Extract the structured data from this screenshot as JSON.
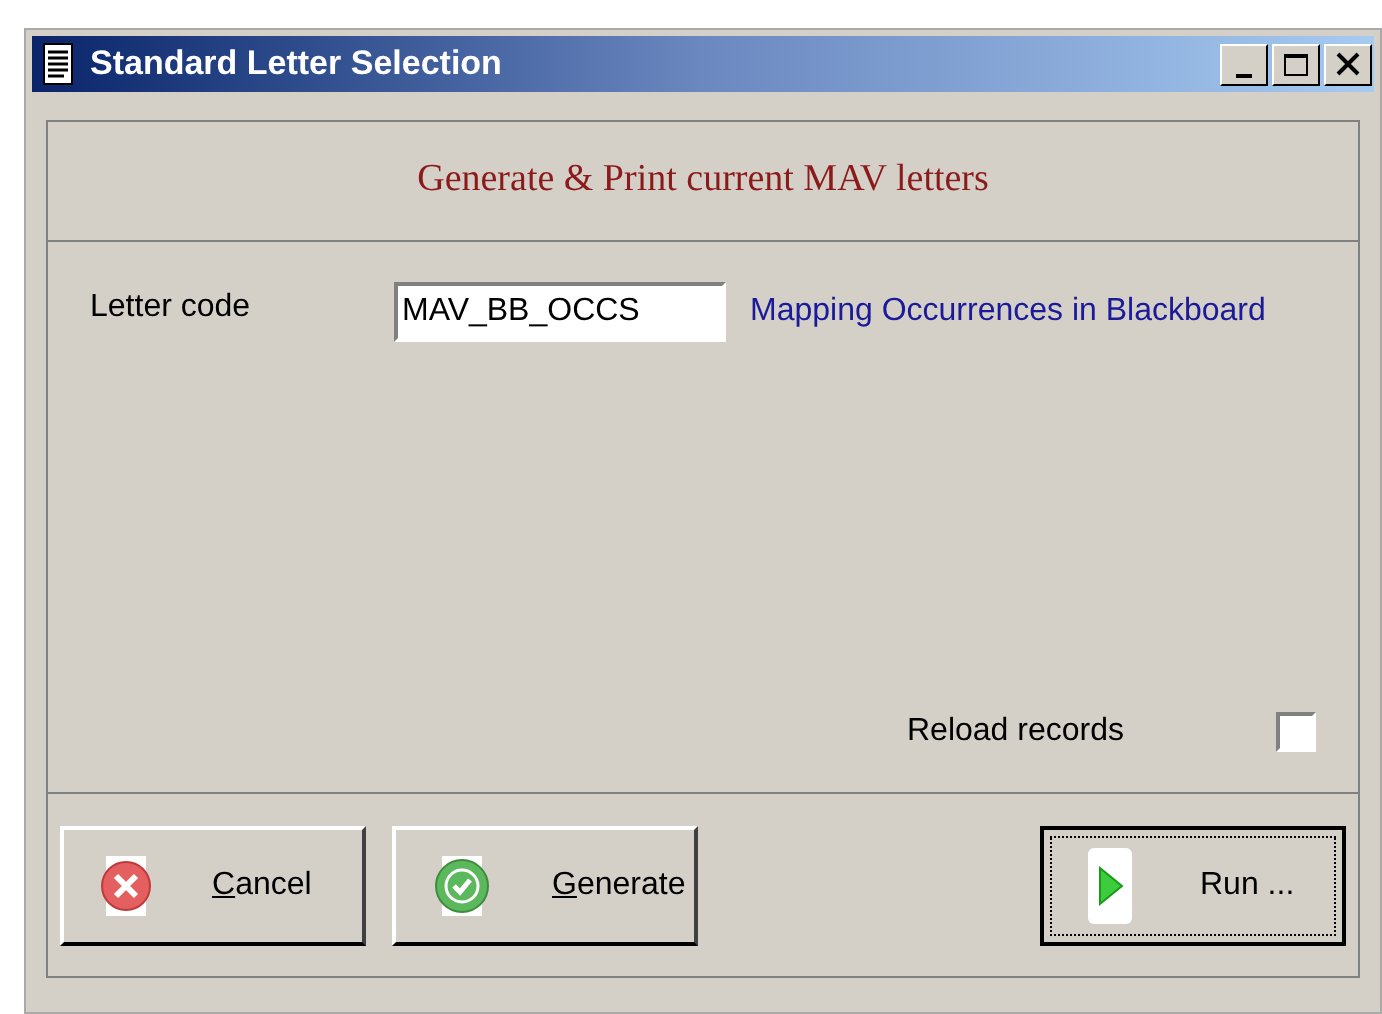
{
  "window": {
    "title": "Standard Letter Selection"
  },
  "header": "Generate & Print current MAV letters",
  "letter_code": {
    "label": "Letter code",
    "value": "MAV_BB_OCCS",
    "description": "Mapping Occurrences in Blackboard"
  },
  "reload": {
    "label": "Reload records",
    "checked": false
  },
  "buttons": [
    {
      "kind": "cancel",
      "label": "Cancel",
      "underline_first": true,
      "default": false
    },
    {
      "kind": "generate",
      "label": "Generate",
      "underline_first": true,
      "default": false
    },
    {
      "kind": "run",
      "label": "Run ...",
      "underline_first": false,
      "default": true
    }
  ]
}
